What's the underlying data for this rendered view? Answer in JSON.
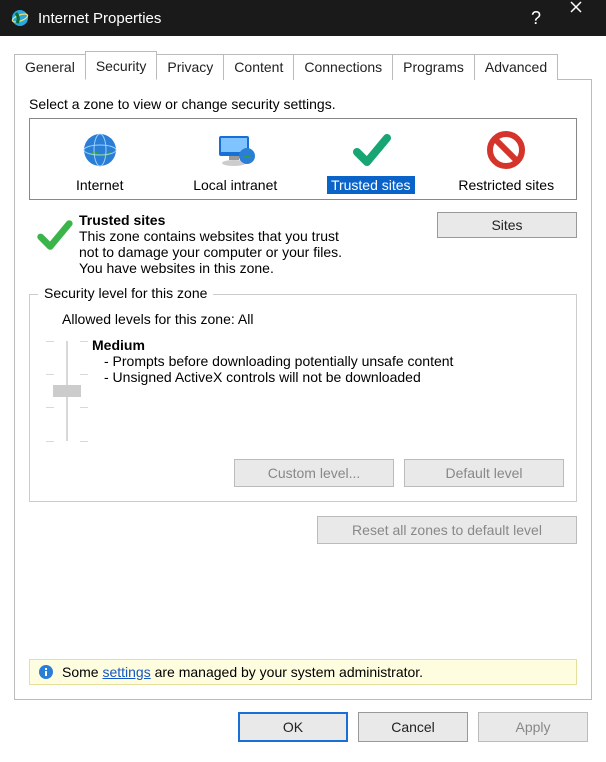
{
  "window": {
    "title": "Internet Properties"
  },
  "tabs": [
    "General",
    "Security",
    "Privacy",
    "Content",
    "Connections",
    "Programs",
    "Advanced"
  ],
  "activeTab": 1,
  "zonePrompt": "Select a zone to view or change security settings.",
  "zones": [
    {
      "label": "Internet"
    },
    {
      "label": "Local intranet"
    },
    {
      "label": "Trusted sites"
    },
    {
      "label": "Restricted sites"
    }
  ],
  "selectedZone": 2,
  "zoneDesc": {
    "title": "Trusted sites",
    "line1": "This zone contains websites that you trust not to damage your computer or your files.",
    "line2": "You have websites in this zone."
  },
  "sitesBtn": "Sites",
  "securityGroup": {
    "title": "Security level for this zone",
    "allowed": "Allowed levels for this zone: All",
    "levelName": "Medium",
    "bullet1": "- Prompts before downloading potentially unsafe content",
    "bullet2": "- Unsigned ActiveX controls will not be downloaded",
    "customBtn": "Custom level...",
    "defaultBtn": "Default level",
    "resetBtn": "Reset all zones to default level"
  },
  "infoBar": {
    "pre": "Some ",
    "link": "settings",
    "post": " are managed by your system administrator."
  },
  "footer": {
    "ok": "OK",
    "cancel": "Cancel",
    "apply": "Apply"
  }
}
